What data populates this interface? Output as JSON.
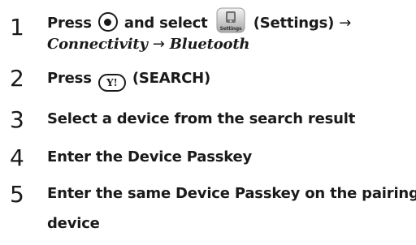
{
  "steps": [
    {
      "number": "1",
      "press": "Press",
      "and_select": "and select",
      "settings_label": "(Settings)",
      "arrow1": "→",
      "icon_text": "Settings",
      "path1": "Connectivity",
      "arrow2": "→",
      "path2": "Bluetooth"
    },
    {
      "number": "2",
      "press": "Press",
      "key_text": "Y!",
      "key_label": "(SEARCH)"
    },
    {
      "number": "3",
      "text": "Select a device from the search result"
    },
    {
      "number": "4",
      "text": "Enter the Device Passkey"
    },
    {
      "number": "5",
      "text_line1": "Enter the same Device Passkey on the pairing",
      "text_line2": "device"
    }
  ]
}
